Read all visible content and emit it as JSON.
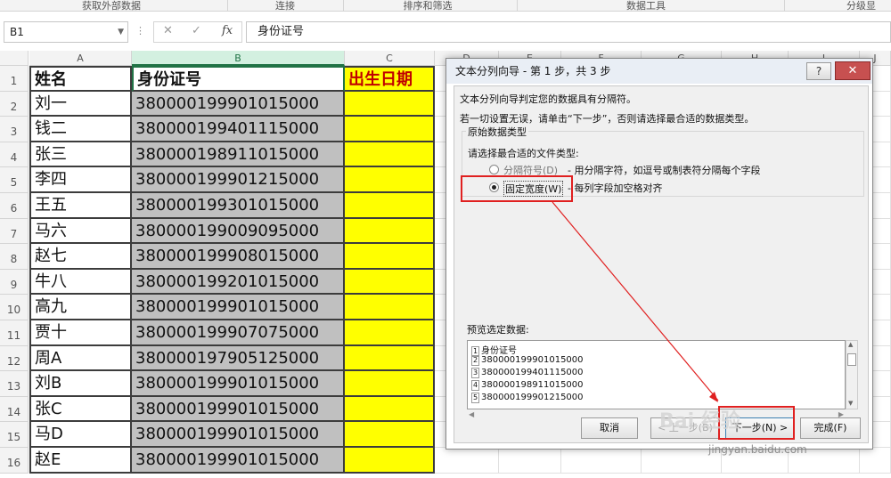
{
  "ribbon": {
    "groups": [
      "获取外部数据",
      "连接",
      "排序和筛选",
      "数据工具",
      "分级显"
    ]
  },
  "formula_bar": {
    "name_box": "B1",
    "cancel_glyph": "✕",
    "enter_glyph": "✓",
    "fx_glyph": "fx",
    "content": "身份证号"
  },
  "columns": [
    "A",
    "B",
    "C",
    "D",
    "E",
    "F",
    "G",
    "H",
    "I",
    "J"
  ],
  "rows": [
    {
      "num": "1",
      "name": "姓名",
      "id": "身份证号",
      "birth": "出生日期"
    },
    {
      "num": "2",
      "name": "刘一",
      "id": "380000199901015000",
      "birth": ""
    },
    {
      "num": "3",
      "name": "钱二",
      "id": "380000199401115000",
      "birth": ""
    },
    {
      "num": "4",
      "name": "张三",
      "id": "380000198911015000",
      "birth": ""
    },
    {
      "num": "5",
      "name": "李四",
      "id": "380000199901215000",
      "birth": ""
    },
    {
      "num": "6",
      "name": "王五",
      "id": "380000199301015000",
      "birth": ""
    },
    {
      "num": "7",
      "name": "马六",
      "id": "380000199009095000",
      "birth": ""
    },
    {
      "num": "8",
      "name": "赵七",
      "id": "380000199908015000",
      "birth": ""
    },
    {
      "num": "9",
      "name": "牛八",
      "id": "380000199201015000",
      "birth": ""
    },
    {
      "num": "10",
      "name": "高九",
      "id": "380000199901015000",
      "birth": ""
    },
    {
      "num": "11",
      "name": "贾十",
      "id": "380000199907075000",
      "birth": ""
    },
    {
      "num": "12",
      "name": "周A",
      "id": "380000197905125000",
      "birth": ""
    },
    {
      "num": "13",
      "name": "刘B",
      "id": "380000199901015000",
      "birth": ""
    },
    {
      "num": "14",
      "name": "张C",
      "id": "380000199901015000",
      "birth": ""
    },
    {
      "num": "15",
      "name": "马D",
      "id": "380000199901015000",
      "birth": ""
    },
    {
      "num": "16",
      "name": "赵E",
      "id": "380000199901015000",
      "birth": ""
    }
  ],
  "dialog": {
    "title": "文本分列向导 - 第 1 步，共 3 步",
    "help": "?",
    "close": "✕",
    "intro1": "文本分列向导判定您的数据具有分隔符。",
    "intro2": "若一切设置无误，请单击“下一步”，否则请选择最合适的数据类型。",
    "section_label": "原始数据类型",
    "file_type_label": "请选择最合适的文件类型:",
    "option_delimited": "分隔符号(D)",
    "option_delimited_desc": "- 用分隔字符，如逗号或制表符分隔每个字段",
    "option_fixed": "固定宽度(W)",
    "option_fixed_desc": "- 每列字段加空格对齐",
    "preview_label": "预览选定数据:",
    "preview_lines": [
      {
        "n": "1",
        "text": "身份证号"
      },
      {
        "n": "2",
        "text": "380000199901015000"
      },
      {
        "n": "3",
        "text": "380000199401115000"
      },
      {
        "n": "4",
        "text": "380000198911015000"
      },
      {
        "n": "5",
        "text": "380000199901215000"
      }
    ],
    "btn_cancel": "取消",
    "btn_back": "< 上一步(B)",
    "btn_next": "下一步(N) >",
    "btn_finish": "完成(F)"
  },
  "watermark": {
    "main": "Bai 经验",
    "url": "jingyan.baidu.com"
  },
  "colors": {
    "highlight": "#ffff00",
    "selected_col": "#c0c0c0",
    "annotation": "#e02020"
  }
}
